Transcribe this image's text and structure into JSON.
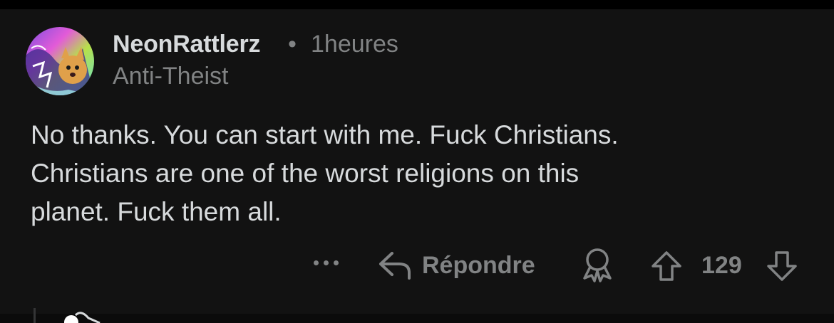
{
  "comment": {
    "author": "NeonRattlerz",
    "separator": "•",
    "time": "1heures",
    "flair": "Anti-Theist",
    "body_lines": [
      "No thanks. You can start with me. Fuck Christians.",
      "Christians are one of the worst religions on this",
      "planet. Fuck them all."
    ]
  },
  "actions": {
    "more_icon": "more-horizontal-icon",
    "reply_icon": "reply-arrow-icon",
    "reply_label": "Répondre",
    "award_icon": "award-icon",
    "upvote_icon": "upvote-arrow-icon",
    "score": "129",
    "downvote_icon": "downvote-arrow-icon"
  },
  "colors": {
    "background": "#121212",
    "text_primary": "#d7dadc",
    "text_secondary": "#818384"
  }
}
